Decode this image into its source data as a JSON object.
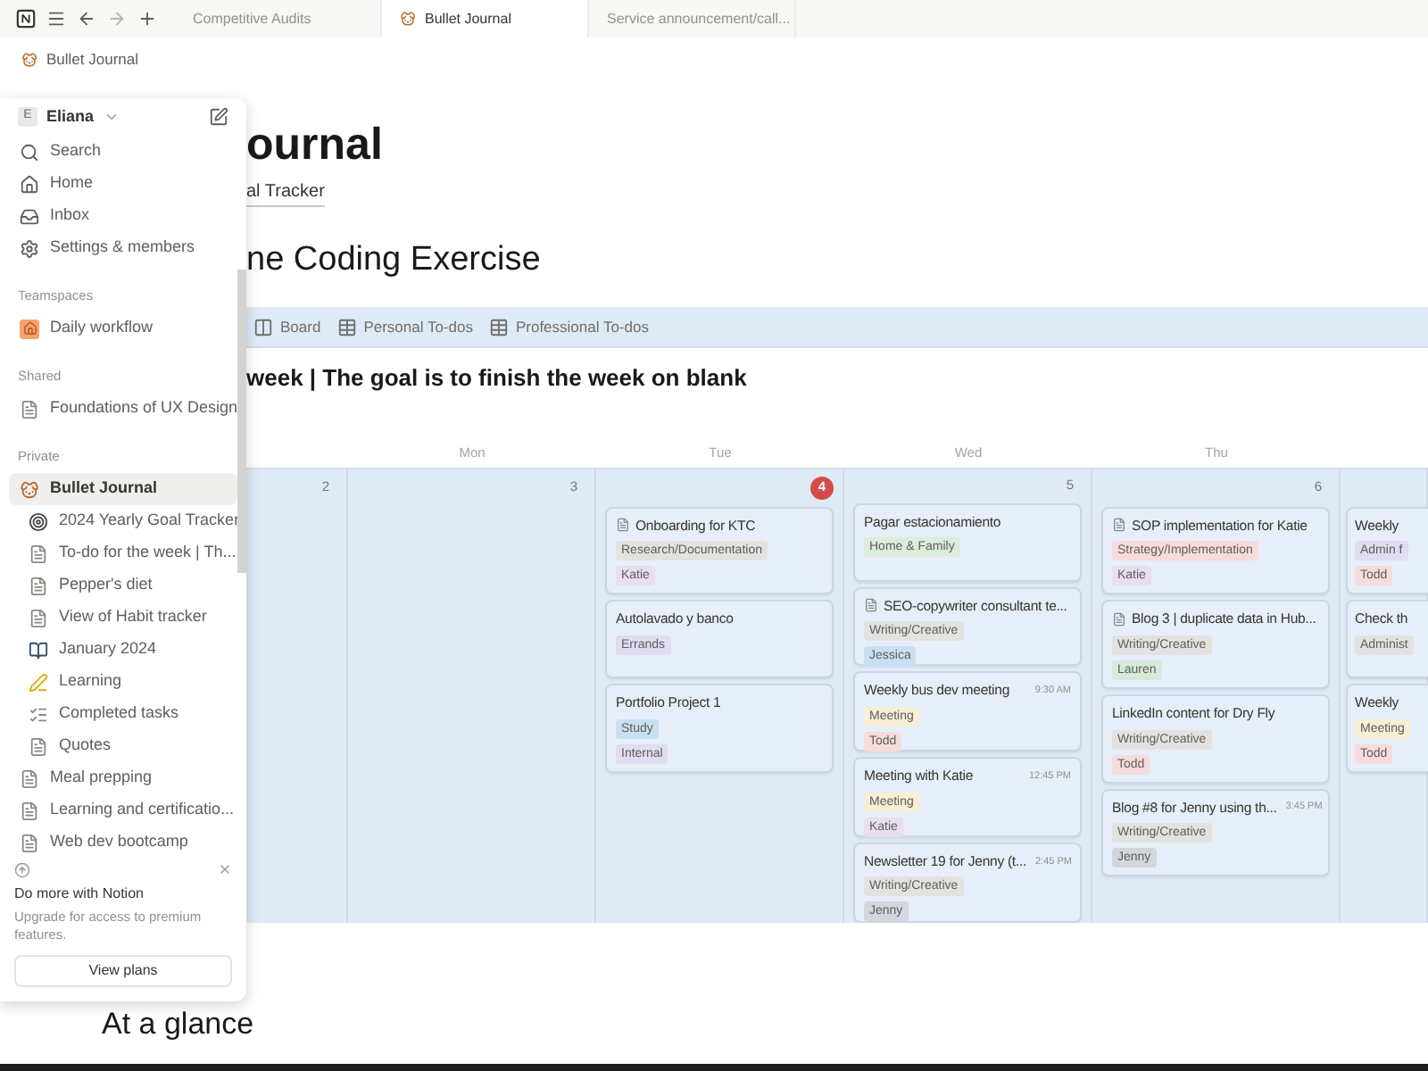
{
  "tabs": [
    {
      "label": "Competitive Audits",
      "selected": false
    },
    {
      "label": "Bullet Journal",
      "selected": true
    },
    {
      "label": "Service announcement/call...",
      "selected": false
    }
  ],
  "breadcrumb": "Bullet Journal",
  "sidebar": {
    "user": {
      "initial": "E",
      "name": "Eliana"
    },
    "nav": [
      {
        "label": "Search",
        "kind": "search"
      },
      {
        "label": "Home",
        "kind": "home"
      },
      {
        "label": "Inbox",
        "kind": "inbox"
      },
      {
        "label": "Settings & members",
        "kind": "settings"
      }
    ],
    "sections": [
      {
        "title": "Teamspaces",
        "items": [
          {
            "label": "Daily workflow",
            "kind": "house",
            "selected": false
          }
        ]
      },
      {
        "title": "Shared",
        "items": [
          {
            "label": "Foundations of UX Design",
            "kind": "page",
            "selected": false
          }
        ]
      },
      {
        "title": "Private",
        "items": [
          {
            "label": "Bullet Journal",
            "kind": "dog",
            "selected": true,
            "children": [
              {
                "label": "2024 Yearly Goal Tracker",
                "kind": "target",
                "selected": false
              },
              {
                "label": "To-do for the week | Th...",
                "kind": "page",
                "selected": false
              },
              {
                "label": "Pepper's diet",
                "kind": "page",
                "selected": false
              },
              {
                "label": "View of Habit tracker",
                "kind": "page",
                "selected": false
              },
              {
                "label": "January 2024",
                "kind": "notebook",
                "selected": false
              },
              {
                "label": "Learning",
                "kind": "pencil",
                "selected": false
              },
              {
                "label": "Completed tasks",
                "kind": "list",
                "selected": false
              },
              {
                "label": "Quotes",
                "kind": "page",
                "selected": false
              }
            ]
          },
          {
            "label": "Meal prepping",
            "kind": "page",
            "selected": false
          },
          {
            "label": "Learning and certificatio...",
            "kind": "page",
            "selected": false
          },
          {
            "label": "Web dev bootcamp",
            "kind": "page",
            "selected": false
          }
        ]
      }
    ],
    "promo": {
      "title": "Do more with Notion",
      "text": "Upgrade for access to premium features.",
      "button": "View plans"
    }
  },
  "page": {
    "title": "ournal",
    "link": "al Tracker",
    "heading": "ne Coding Exercise",
    "views": [
      {
        "label": "Board",
        "kind": "board"
      },
      {
        "label": "Personal To-dos",
        "kind": "table"
      },
      {
        "label": "Professional To-dos",
        "kind": "table"
      }
    ],
    "calendar_title": "week | The goal is to finish the week on blank",
    "calendar": {
      "days": [
        {
          "number": "2",
          "today": false
        },
        {
          "weekday": "Mon",
          "number": "3",
          "today": false
        },
        {
          "weekday": "Tue",
          "number": "4",
          "today": true,
          "cards": [
            {
              "title": "Onboarding for KTC",
              "kind": "page",
              "tags": [
                {
                  "label": "Research/Documentation",
                  "color": "#e3e2e0"
                },
                {
                  "label": "Katie",
                  "color": "#e8deee"
                }
              ]
            },
            {
              "title": "Autolavado y banco",
              "kind": "plain",
              "tags": [
                {
                  "label": "Errands",
                  "color": "#e0dcf2"
                }
              ]
            },
            {
              "title": "Portfolio Project 1",
              "kind": "plain",
              "tags": [
                {
                  "label": "Study",
                  "color": "#c9e0f2"
                },
                {
                  "label": "Internal",
                  "color": "#e0dcf2"
                }
              ]
            }
          ]
        },
        {
          "weekday": "Wed",
          "number": "5",
          "today": false,
          "cards": [
            {
              "title": "Pagar estacionamiento",
              "kind": "plain",
              "tags": [
                {
                  "label": "Home & Family",
                  "color": "#dbeddb"
                }
              ]
            },
            {
              "title": "SEO-copywriter consultant te...",
              "kind": "page",
              "tags": [
                {
                  "label": "Writing/Creative",
                  "color": "#e3e2e0"
                },
                {
                  "label": "Jessica",
                  "color": "#c9e0f2"
                }
              ]
            },
            {
              "title": "Weekly bus dev meeting",
              "kind": "plain",
              "time": "9:30 AM",
              "tags": [
                {
                  "label": "Meeting",
                  "color": "#f5efd6"
                },
                {
                  "label": "Todd",
                  "color": "#f6dcdc"
                }
              ]
            },
            {
              "title": "Meeting with Katie",
              "kind": "plain",
              "time": "12:45 PM",
              "tags": [
                {
                  "label": "Meeting",
                  "color": "#f5efd6"
                },
                {
                  "label": "Katie",
                  "color": "#e8deee"
                }
              ]
            },
            {
              "title": "Newsletter 19 for Jenny (t...",
              "kind": "plain",
              "time": "2:45 PM",
              "tags": [
                {
                  "label": "Writing/Creative",
                  "color": "#e3e2e0"
                },
                {
                  "label": "Jenny",
                  "color": "#d3d6dc"
                }
              ]
            }
          ]
        },
        {
          "weekday": "Thu",
          "number": "6",
          "today": false,
          "cards": [
            {
              "title": "SOP implementation for Katie",
              "kind": "page",
              "tags": [
                {
                  "label": "Strategy/Implementation",
                  "color": "#f6dcdc"
                },
                {
                  "label": "Katie",
                  "color": "#e8deee"
                }
              ]
            },
            {
              "title": "Blog 3 | duplicate data in Hub...",
              "kind": "page",
              "tags": [
                {
                  "label": "Writing/Creative",
                  "color": "#e3e2e0"
                },
                {
                  "label": "Lauren",
                  "color": "#d5ead8"
                }
              ]
            },
            {
              "title": "LinkedIn content for Dry Fly",
              "kind": "plain",
              "tags": [
                {
                  "label": "Writing/Creative",
                  "color": "#e3e2e0"
                },
                {
                  "label": "Todd",
                  "color": "#f6dcdc"
                }
              ]
            },
            {
              "title": "Blog #8 for Jenny using th...",
              "kind": "plain",
              "time": "3:45 PM",
              "tags": [
                {
                  "label": "Writing/Creative",
                  "color": "#e3e2e0"
                },
                {
                  "label": "Jenny",
                  "color": "#d3d6dc"
                }
              ]
            }
          ]
        },
        {
          "cards": [
            {
              "title": "Weekly",
              "kind": "plain",
              "tags": [
                {
                  "label": "Admin f",
                  "color": "#e0dcf2"
                },
                {
                  "label": "Todd",
                  "color": "#f6dcdc"
                }
              ]
            },
            {
              "title": "Check th",
              "kind": "plain",
              "tags": [
                {
                  "label": "Administ",
                  "color": "#e3e2e0"
                }
              ]
            },
            {
              "title": "Weekly",
              "kind": "plain",
              "tags": [
                {
                  "label": "Meeting",
                  "color": "#f5efd6"
                },
                {
                  "label": "Todd",
                  "color": "#f6dcdc"
                }
              ]
            }
          ]
        }
      ]
    },
    "section_heading": "At a glance"
  }
}
